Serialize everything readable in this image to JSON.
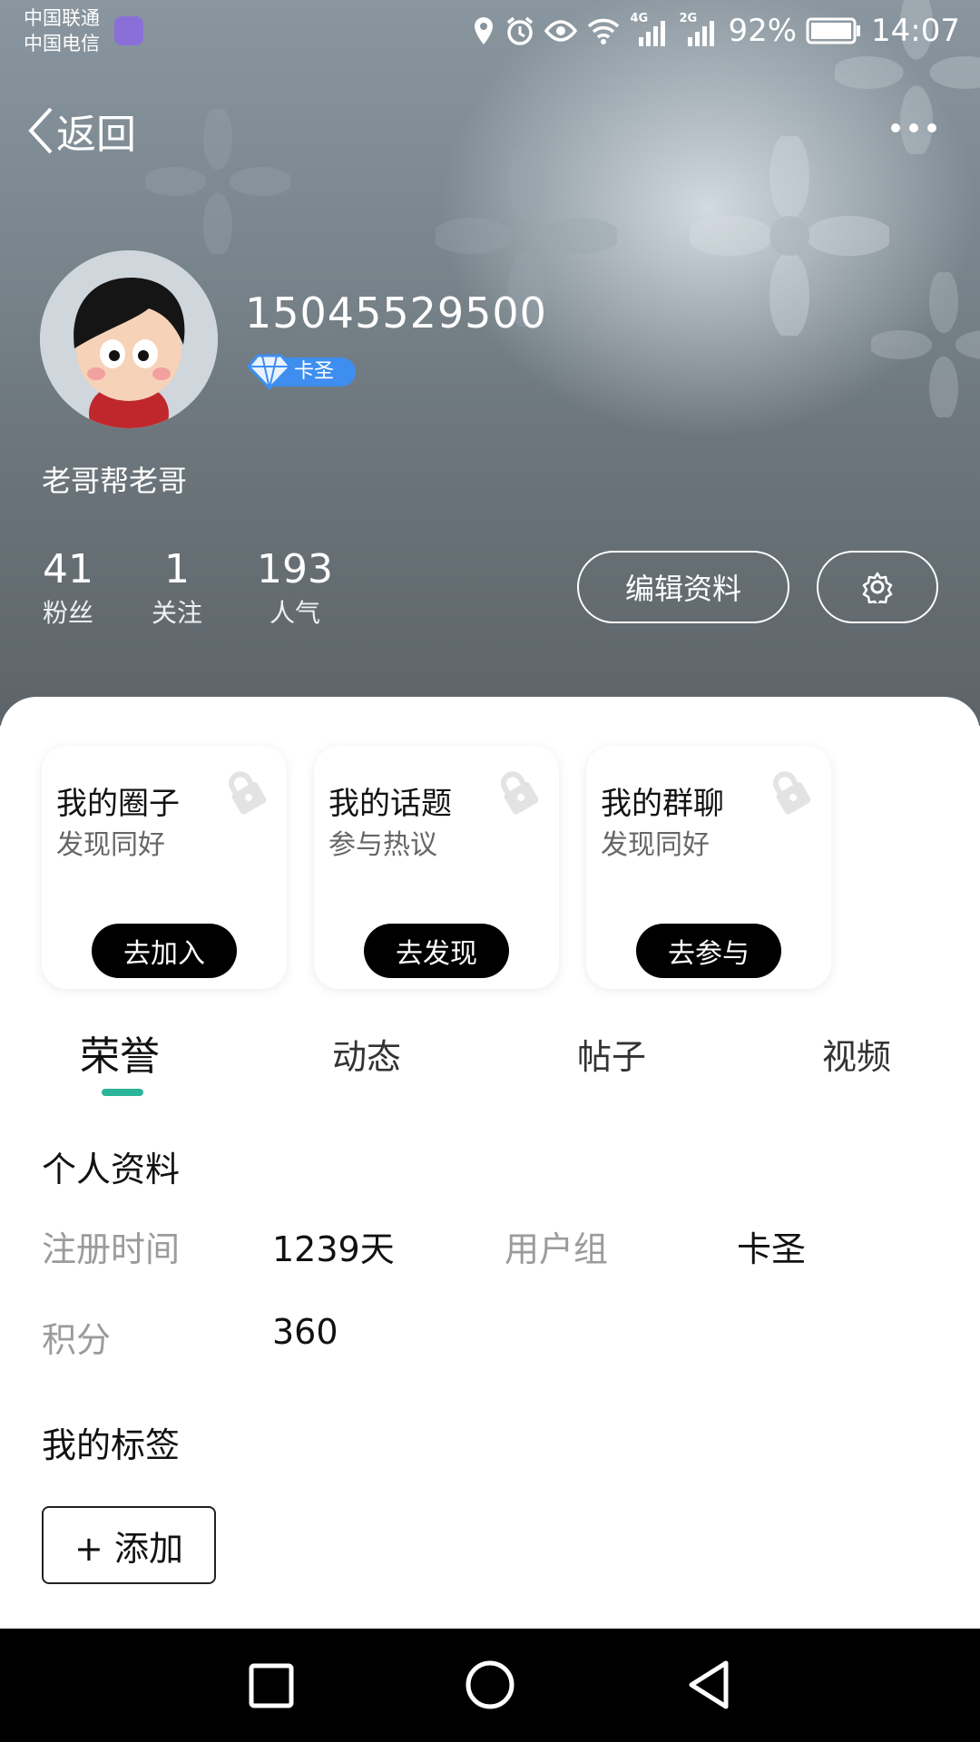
{
  "status_bar": {
    "carrier_1": "中国联通",
    "carrier_2": "中国电信",
    "battery": "92%",
    "time": "14:07",
    "network_1": "4G",
    "network_2": "2G"
  },
  "nav": {
    "back_label": "返回"
  },
  "profile": {
    "username": "15045529500",
    "badge": "卡圣",
    "bio": "老哥帮老哥",
    "stats": [
      {
        "value": "41",
        "label": "粉丝"
      },
      {
        "value": "1",
        "label": "关注"
      },
      {
        "value": "193",
        "label": "人气"
      }
    ],
    "edit_label": "编辑资料"
  },
  "cards": [
    {
      "title": "我的圈子",
      "subtitle": "发现同好",
      "button": "去加入"
    },
    {
      "title": "我的话题",
      "subtitle": "参与热议",
      "button": "去发现"
    },
    {
      "title": "我的群聊",
      "subtitle": "发现同好",
      "button": "去参与"
    }
  ],
  "tabs": [
    "荣誉",
    "动态",
    "帖子",
    "视频"
  ],
  "active_tab": "荣誉",
  "personal_info": {
    "title": "个人资料",
    "register_label": "注册时间",
    "register_value": "1239天",
    "group_label": "用户组",
    "group_value": "卡圣",
    "points_label": "积分",
    "points_value": "360"
  },
  "tags": {
    "title": "我的标签",
    "add_label": "+ 添加"
  },
  "colors": {
    "accent": "#2bb59a",
    "badge": "#3e8ef0",
    "button_dark": "#000000"
  }
}
